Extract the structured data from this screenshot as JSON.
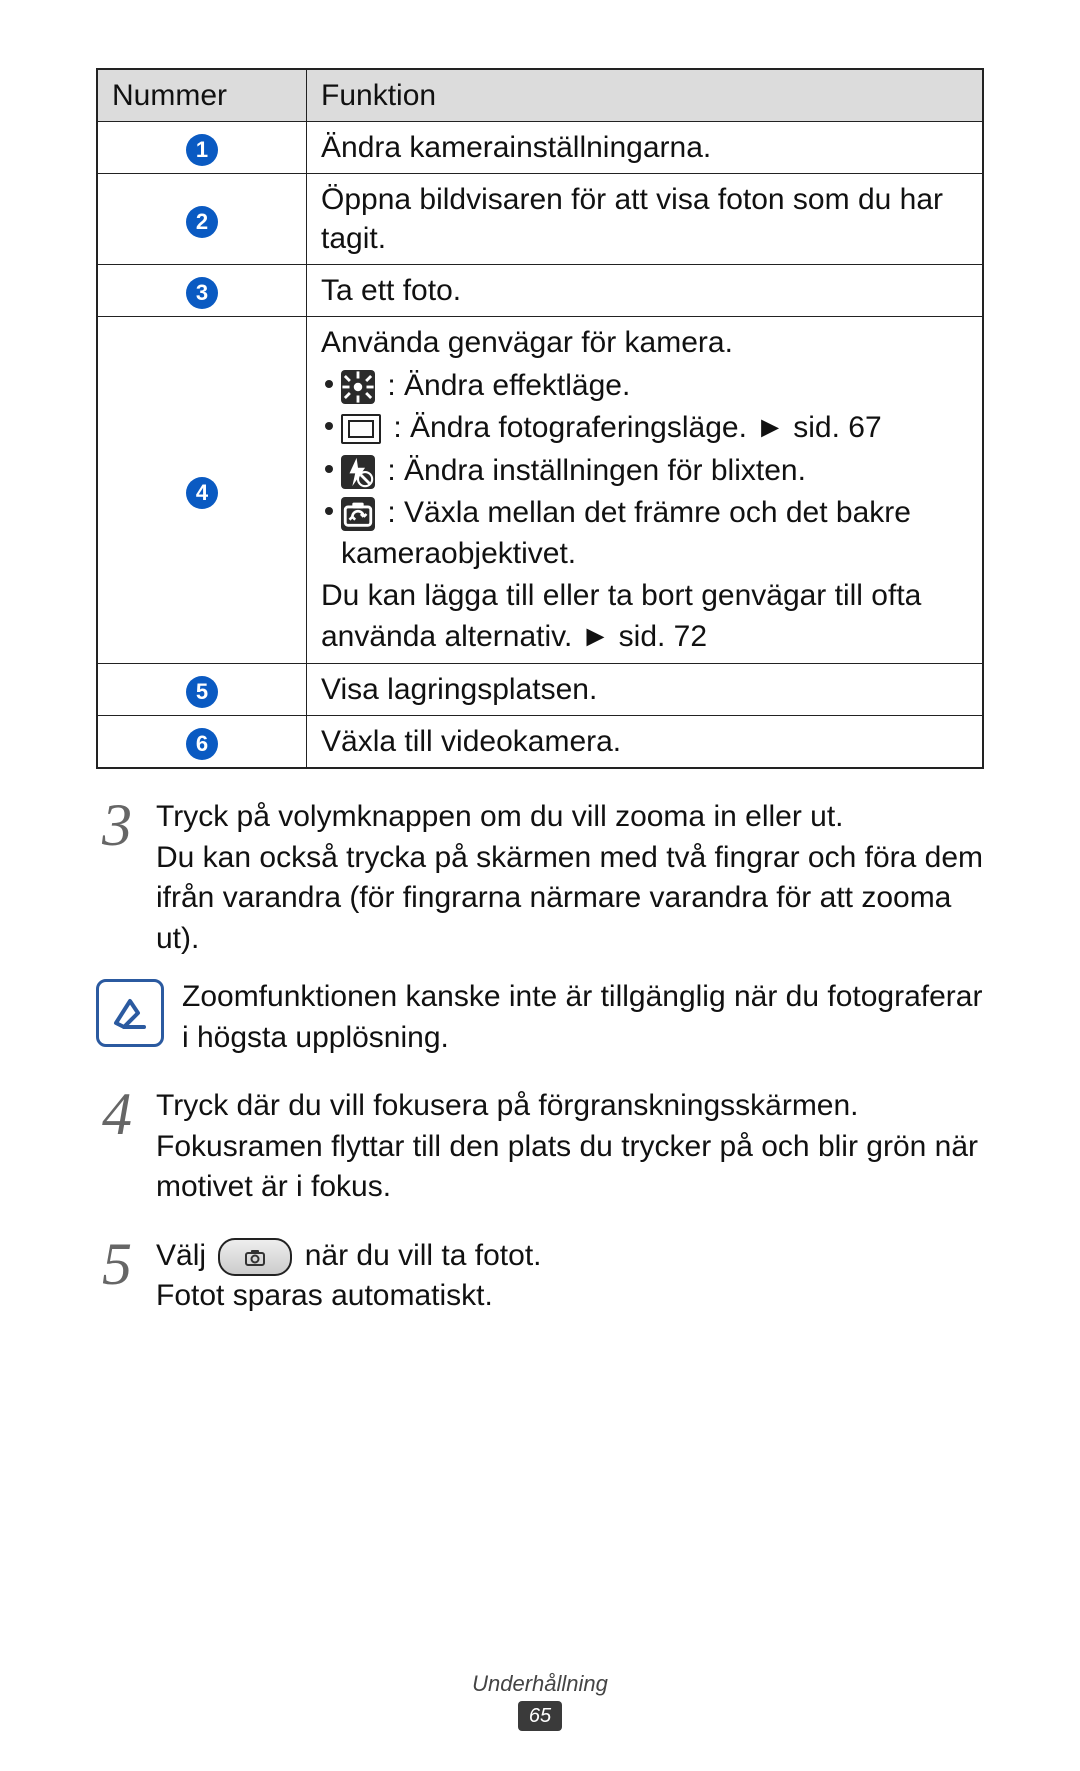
{
  "table": {
    "headers": {
      "num": "Nummer",
      "func": "Funktion"
    },
    "rows": {
      "r1": "Ändra kamerainställningarna.",
      "r2": "Öppna bildvisaren för att visa foton som du har tagit.",
      "r3": "Ta ett foto.",
      "r4_title": "Använda genvägar för kamera.",
      "r4_b1": ": Ändra effektläge.",
      "r4_b2a": ": Ändra fotograferingsläge. ",
      "r4_b2b": "► sid. 67",
      "r4_b3": ": Ändra inställningen för blixten.",
      "r4_b4": ": Växla mellan det främre och det bakre kameraobjektivet.",
      "r4_foot1": "Du kan lägga till eller ta bort genvägar till ofta använda alternativ. ",
      "r4_foot2": "► sid. 72",
      "r5": "Visa lagringsplatsen.",
      "r6": "Växla till videokamera."
    },
    "nums": {
      "n1": "1",
      "n2": "2",
      "n3": "3",
      "n4": "4",
      "n5": "5",
      "n6": "6"
    }
  },
  "steps": {
    "s3num": "3",
    "s3a": "Tryck på volymknappen om du vill zooma in eller ut.",
    "s3b": "Du kan också trycka på skärmen med två fingrar och föra dem ifrån varandra (för fingrarna närmare varandra för att zooma ut).",
    "note": "Zoomfunktionen kanske inte är tillgänglig när du fotograferar i högsta upplösning.",
    "s4num": "4",
    "s4a": "Tryck där du vill fokusera på förgranskningsskärmen.",
    "s4b": "Fokusramen flyttar till den plats du trycker på och blir grön när motivet är i fokus.",
    "s5num": "5",
    "s5a_pre": "Välj ",
    "s5a_post": " när du vill ta fotot.",
    "s5b": "Fotot sparas automatiskt."
  },
  "footer": {
    "section": "Underhållning",
    "page": "65"
  }
}
